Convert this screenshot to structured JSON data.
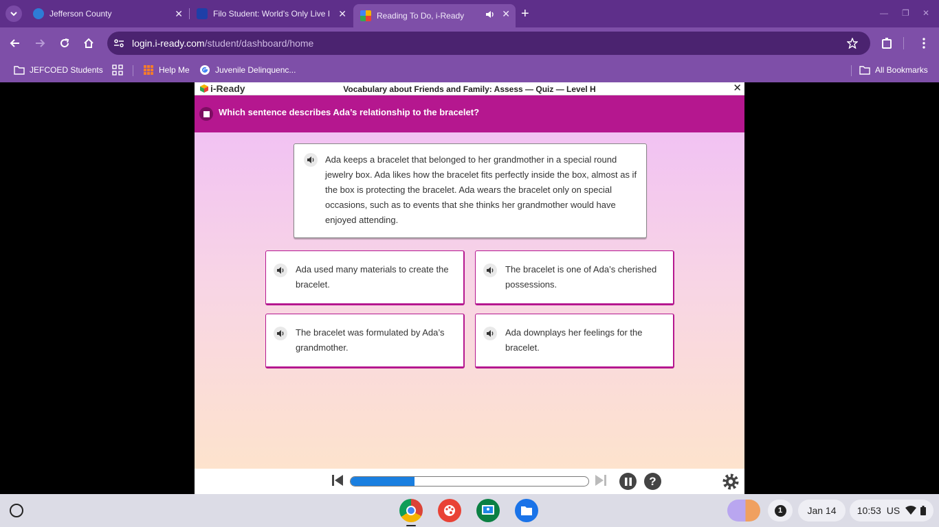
{
  "browser": {
    "tabs": [
      {
        "label": "Jefferson County",
        "active": false
      },
      {
        "label": "Filo Student: World's Only Live I",
        "active": false
      },
      {
        "label": "Reading To Do, i-Ready",
        "active": true
      }
    ],
    "address": {
      "domain": "login.i-ready.com",
      "path": "/student/dashboard/home"
    },
    "bookmarks": [
      {
        "label": "JEFCOED Students",
        "icon": "folder-icon"
      },
      {
        "label": "Help Me",
        "icon": "apps-grid-icon"
      },
      {
        "label": "Juvenile Delinquenc...",
        "icon": "google-icon"
      }
    ],
    "all_bookmarks": "All Bookmarks"
  },
  "app": {
    "brand": "i-Ready",
    "quiz_title": "Vocabulary about Friends and Family: Assess — Quiz — Level H",
    "question": "Which sentence describes Ada’s relationship to the bracelet?",
    "passage": "Ada keeps a bracelet that belonged to her grandmother in a special round jewelry box. Ada likes how the bracelet fits perfectly inside the box, almost as if the box is protecting the bracelet. Ada wears the bracelet only on special occasions, such as to events that she thinks her grandmother would have enjoyed attending.",
    "answers": [
      "Ada used many materials to create the bracelet.",
      "The bracelet is one of Ada’s cherished possessions.",
      "The bracelet was formulated by Ada’s grandmother.",
      "Ada downplays her feelings for the bracelet."
    ],
    "player": {
      "progress": 0.27,
      "help_label": "?"
    },
    "colors": {
      "accent": "#b5178f",
      "progress": "#1a7fe0",
      "browser": "#7e4fa8"
    }
  },
  "shelf": {
    "apps": [
      "chrome-icon",
      "canvas-icon",
      "classroom-icon",
      "files-icon"
    ],
    "notification_count": "1",
    "date": "Jan 14",
    "time": "10:53",
    "locale": "US"
  }
}
